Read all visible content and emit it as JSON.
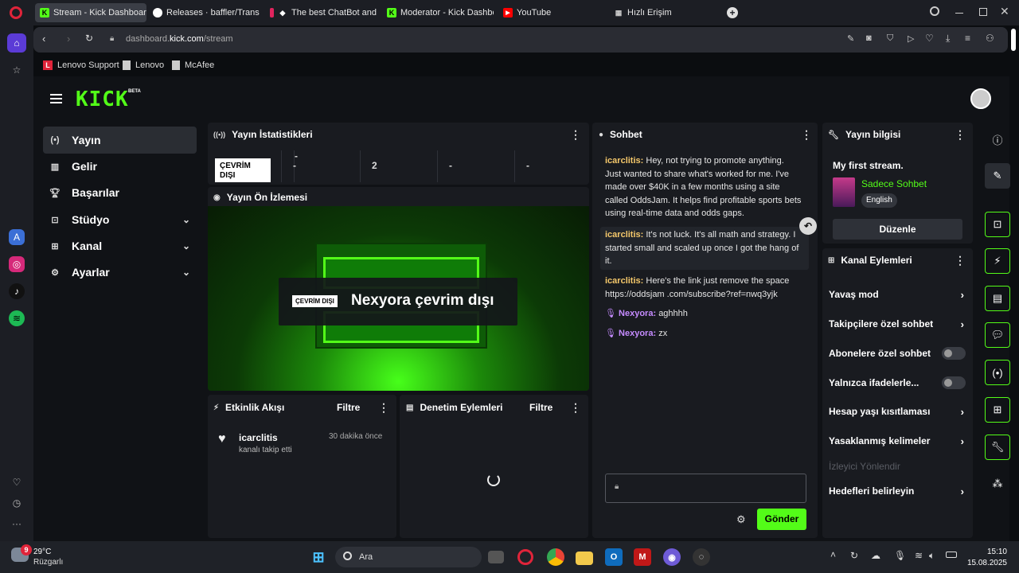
{
  "browser": {
    "tabs": [
      {
        "label": "Stream - Kick Dashboard",
        "active": true
      },
      {
        "label": "Releases · baffler/Transpar"
      },
      {
        "label": "The best ChatBot and Wid"
      },
      {
        "label": "Moderator - Kick Dashboa"
      },
      {
        "label": "YouTube"
      },
      {
        "label": "Hızlı Erişim"
      }
    ],
    "url_prefix": "dashboard.",
    "url_domain": "kick.com",
    "url_path": "/stream",
    "bookmarks": [
      "Lenovo Support",
      "Lenovo",
      "McAfee"
    ]
  },
  "logo": {
    "text": "KICK",
    "badge": "BETA"
  },
  "nav": {
    "items": [
      {
        "label": "Yayın",
        "active": true
      },
      {
        "label": "Gelir"
      },
      {
        "label": "Başarılar"
      },
      {
        "label": "Stüdyo",
        "expandable": true
      },
      {
        "label": "Kanal",
        "expandable": true
      },
      {
        "label": "Ayarlar",
        "expandable": true
      }
    ]
  },
  "stats": {
    "title": "Yayın İstatistikleri",
    "status_badge": "ÇEVRİM DIŞI",
    "values": [
      "-",
      "2",
      "-",
      "-"
    ]
  },
  "preview": {
    "title": "Yayın Ön İzlemesi",
    "badge": "ÇEVRİM DIŞI",
    "text": "Nexyora çevrim dışı"
  },
  "activity": {
    "title": "Etkinlik Akışı",
    "filter": "Filtre",
    "items": [
      {
        "user": "icarclitis",
        "action": "kanalı takip etti",
        "time": "30 dakika önce"
      }
    ]
  },
  "moderation": {
    "title": "Denetim Eylemleri",
    "filter": "Filtre"
  },
  "chat": {
    "title": "Sohbet",
    "messages": [
      {
        "user": "icarclitis",
        "text": "Hey, not trying to promote anything. Just wanted to share what's worked for me. I've made over $40K in a few months using a site called OddsJam. It helps find profitable sports bets using real-time data and odds gaps."
      },
      {
        "user": "icarclitis",
        "text": "It's not luck. It's all math and strategy. I started small and scaled up once I got the hang of it."
      },
      {
        "user": "icarclitis",
        "text": "Here's the link just remove the space https://oddsjam .com/subscribe?ref=nwq3yjk"
      },
      {
        "user": "Nexyora",
        "text": "aghhhh"
      },
      {
        "user": "Nexyora",
        "text": "zx"
      }
    ],
    "send_label": "Gönder"
  },
  "stream_info": {
    "title": "Yayın bilgisi",
    "stream_title": "My first stream.",
    "category": "Sadece Sohbet",
    "language": "English",
    "edit_label": "Düzenle"
  },
  "channel_actions": {
    "title": "Kanal Eylemleri",
    "items": [
      {
        "label": "Yavaş mod",
        "type": "arrow"
      },
      {
        "label": "Takipçilere özel sohbet",
        "type": "arrow"
      },
      {
        "label": "Abonelere özel sohbet",
        "type": "toggle"
      },
      {
        "label": "Yalnızca ifadelerle...",
        "type": "toggle"
      },
      {
        "label": "Hesap yaşı kısıtlaması",
        "type": "arrow"
      },
      {
        "label": "Yasaklanmış kelimeler",
        "type": "arrow"
      },
      {
        "label": "İzleyici Yönlendir",
        "type": "disabled"
      },
      {
        "label": "Hedefleri belirleyin",
        "type": "arrow"
      }
    ]
  },
  "taskbar": {
    "weather_temp": "29°C",
    "weather_desc": "Rüzgarlı",
    "search_label": "Ara",
    "time": "15:10",
    "date": "15.08.2025",
    "notif_count": "9"
  },
  "colors": {
    "accent": "#53fc18",
    "panel": "#191b20"
  }
}
